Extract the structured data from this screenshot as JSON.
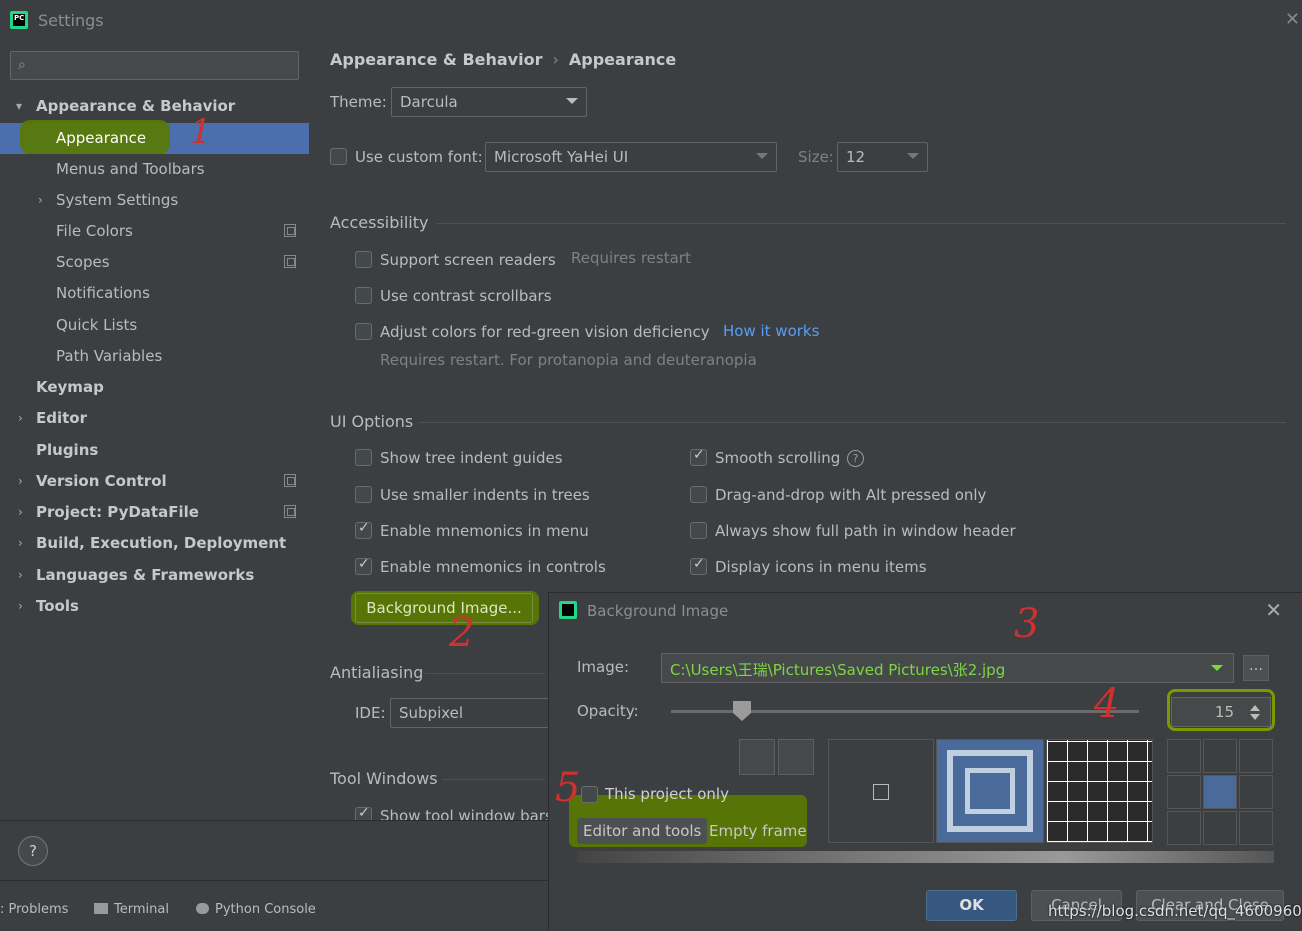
{
  "window": {
    "title": "Settings"
  },
  "sidebar": {
    "search_placeholder": "",
    "items": [
      {
        "label": "Appearance & Behavior",
        "expanded": true
      },
      {
        "label": "Appearance"
      },
      {
        "label": "Menus and Toolbars"
      },
      {
        "label": "System Settings"
      },
      {
        "label": "File Colors"
      },
      {
        "label": "Scopes"
      },
      {
        "label": "Notifications"
      },
      {
        "label": "Quick Lists"
      },
      {
        "label": "Path Variables"
      },
      {
        "label": "Keymap"
      },
      {
        "label": "Editor"
      },
      {
        "label": "Plugins"
      },
      {
        "label": "Version Control"
      },
      {
        "label": "Project: PyDataFile"
      },
      {
        "label": "Build, Execution, Deployment"
      },
      {
        "label": "Languages & Frameworks"
      },
      {
        "label": "Tools"
      }
    ]
  },
  "main": {
    "breadcrumb": [
      "Appearance & Behavior",
      "Appearance"
    ],
    "theme_label": "Theme:",
    "theme_value": "Darcula",
    "custom_font_label": "Use custom font:",
    "custom_font_value": "Microsoft YaHei UI",
    "size_label": "Size:",
    "size_value": "12",
    "accessibility": {
      "title": "Accessibility",
      "screen_readers": "Support screen readers",
      "requires_restart": "Requires restart",
      "contrast_scrollbars": "Use contrast scrollbars",
      "red_green": "Adjust colors for red-green vision deficiency",
      "how_it_works": "How it works",
      "red_green_note": "Requires restart. For protanopia and deuteranopia"
    },
    "ui_options": {
      "title": "UI Options",
      "tree_indent": "Show tree indent guides",
      "smaller_indents": "Use smaller indents in trees",
      "mnemonics_menu": "Enable mnemonics in menu",
      "mnemonics_controls": "Enable mnemonics in controls",
      "smooth_scrolling": "Smooth scrolling",
      "drag_drop_alt": "Drag-and-drop with Alt pressed only",
      "full_path": "Always show full path in window header",
      "display_icons": "Display icons in menu items",
      "background_image_btn": "Background Image..."
    },
    "antialiasing": {
      "title": "Antialiasing",
      "ide_label": "IDE:",
      "ide_value": "Subpixel"
    },
    "tool_windows": {
      "title": "Tool Windows",
      "show_bars": "Show tool window bars"
    }
  },
  "statusbar": {
    "problems": ": Problems",
    "terminal": "Terminal",
    "python_console": "Python Console"
  },
  "dialog": {
    "title": "Background Image",
    "image_label": "Image:",
    "image_path": "C:\\Users\\王瑞\\Pictures\\Saved Pictures\\张2.jpg",
    "browse": "...",
    "opacity_label": "Opacity:",
    "opacity_value": "15",
    "opacity_level": 0.15,
    "this_project_only": "This project only",
    "mode_editor_tools": "Editor and tools",
    "mode_empty_frame": "Empty frame",
    "ok": "OK",
    "cancel": "Cancel",
    "clear_close": "Clear and Close"
  },
  "annotations": [
    "1",
    "2",
    "3",
    "4",
    "5"
  ],
  "watermark": "https://blog.csdn.net/qq_46009608",
  "colors": {
    "selection": "#4b6eaf",
    "highlight": "#5a7a00",
    "link": "#589df6",
    "ok_button": "#365880"
  }
}
